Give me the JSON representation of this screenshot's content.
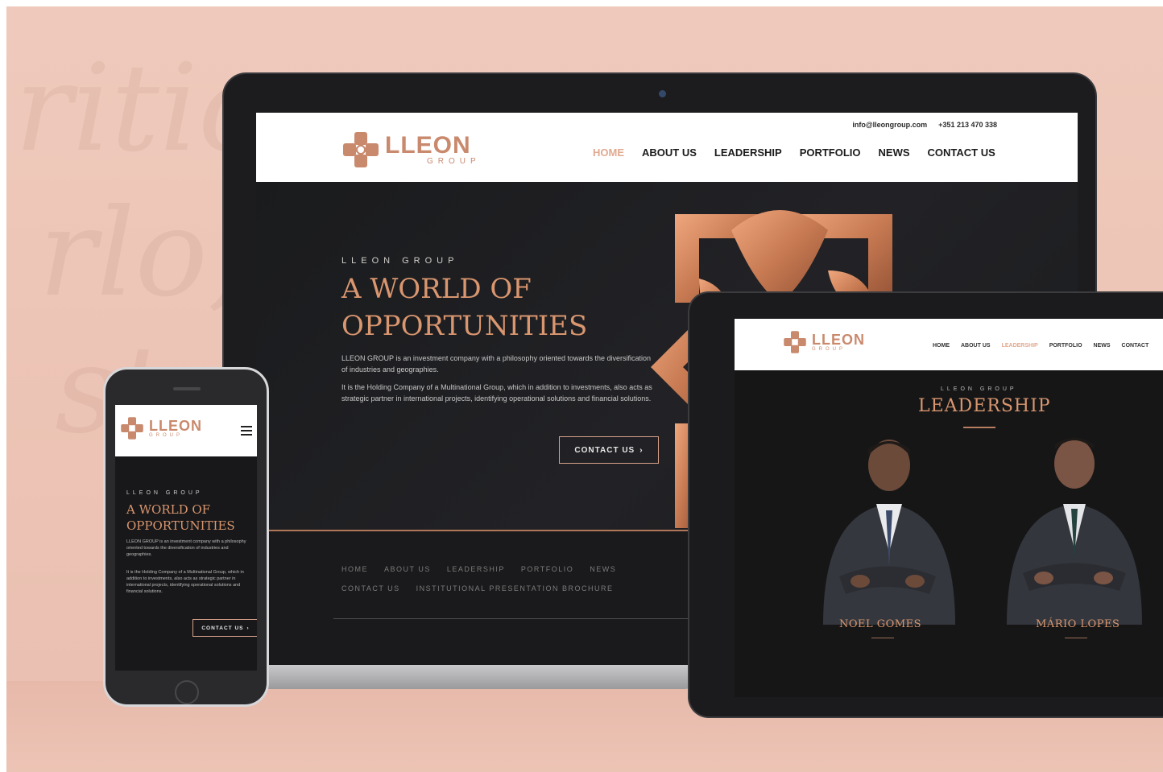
{
  "colors": {
    "accent": "#d9966f",
    "brand": "#c9896d",
    "dark": "#1b1b1d",
    "background": "#ecc4b5"
  },
  "brand": {
    "name": "LLEON",
    "sub": "GROUP"
  },
  "laptop": {
    "contact_email": "info@lleongroup.com",
    "contact_phone": "+351 213 470 338",
    "nav": [
      "HOME",
      "ABOUT US",
      "LEADERSHIP",
      "PORTFOLIO",
      "NEWS",
      "CONTACT US"
    ],
    "active_nav": "HOME",
    "hero": {
      "kicker": "LLEON GROUP",
      "title_line1": "A WORLD OF",
      "title_line2": "OPPORTUNITIES",
      "paragraph1": "LLEON GROUP is an investment company with a philosophy oriented towards the diversification of industries and geographies.",
      "paragraph2": "It is the Holding Company of a Multinational Group, which in addition to investments, also acts as strategic partner in international projects, identifying operational solutions and financial solutions.",
      "button": "CONTACT US"
    },
    "footer_nav_row1": [
      "HOME",
      "ABOUT US",
      "LEADERSHIP",
      "PORTFOLIO",
      "NEWS"
    ],
    "footer_nav_row2": [
      "CONTACT US",
      "INSTITUTIONAL PRESENTATION BROCHURE"
    ]
  },
  "tablet": {
    "nav": [
      "HOME",
      "ABOUT US",
      "LEADERSHIP",
      "PORTFOLIO",
      "NEWS",
      "CONTACT"
    ],
    "active_nav": "LEADERSHIP",
    "kicker": "LLEON GROUP",
    "title": "LEADERSHIP",
    "people": [
      {
        "name": "NOEL GOMES"
      },
      {
        "name": "MÁRIO LOPES"
      }
    ]
  },
  "phone": {
    "kicker": "LLEON GROUP",
    "title_line1": "A WORLD OF",
    "title_line2": "OPPORTUNITIES",
    "paragraph1": "LLEON GROUP is an investment company with a philosophy oriented towards the diversification of industries and geographies.",
    "paragraph2": "It is the Holding Company of a Multinational Group, which in addition to investments, also acts as strategic partner in international projects, identifying operational solutions and financial solutions.",
    "button": "CONTACT US",
    "menu_icon": "hamburger-menu-icon"
  },
  "icons": {
    "logo": "lleon-flower-logo-icon",
    "chevron": "chevron-right-icon"
  }
}
